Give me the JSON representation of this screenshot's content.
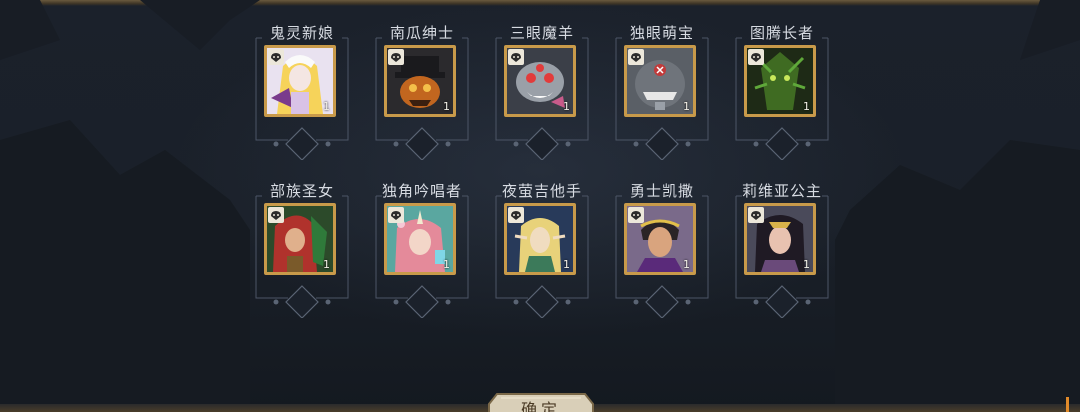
{
  "hero_slots": [
    {
      "name": "鬼灵新娘",
      "level": "1"
    },
    {
      "name": "南瓜绅士",
      "level": "1"
    },
    {
      "name": "三眼魔羊",
      "level": "1"
    },
    {
      "name": "独眼萌宝",
      "level": "1"
    },
    {
      "name": "图腾长者",
      "level": "1"
    },
    {
      "name": "部族圣女",
      "level": "1"
    },
    {
      "name": "独角吟唱者",
      "level": "1"
    },
    {
      "name": "夜萤吉他手",
      "level": "1"
    },
    {
      "name": "勇士凯撒",
      "level": "1"
    },
    {
      "name": "莉维亚公主",
      "level": "1"
    }
  ],
  "confirm_button": {
    "label": "确定"
  },
  "colors": {
    "frame_gold": "#c89a4a",
    "name_text": "#d7dbe2",
    "accent_orange": "#e08a2a"
  }
}
